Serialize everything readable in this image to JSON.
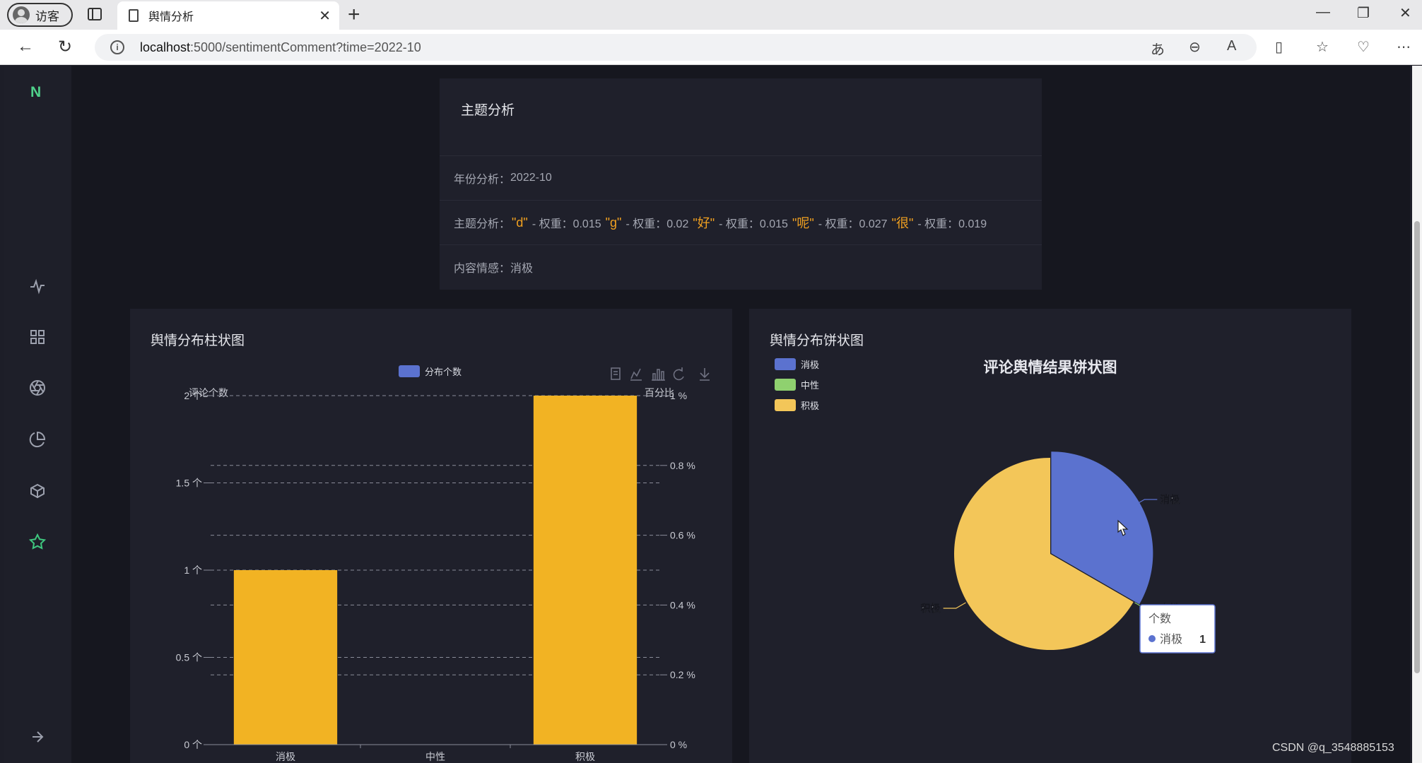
{
  "browser": {
    "profile_label": "访客",
    "tab_title": "舆情分析",
    "url_host": "localhost",
    "url_path": ":5000/sentimentComment?time=2022-10"
  },
  "sidebar": {
    "logo": "N",
    "items": [
      "activity-icon",
      "grid-icon",
      "aperture-icon",
      "pie-icon",
      "box-icon",
      "star-icon"
    ],
    "expand_icon": "arrow-right-icon"
  },
  "topic": {
    "title": "主题分析",
    "year_label": "年份分析：",
    "year_value": "2022-10",
    "theme_label": "主题分析：",
    "keywords": [
      {
        "word": "\"d\"",
        "rest": "- 权重：0.015"
      },
      {
        "word": "\"g\"",
        "rest": "- 权重：0.02"
      },
      {
        "word": "\"好\"",
        "rest": "- 权重：0.015"
      },
      {
        "word": "\"呢\"",
        "rest": "- 权重：0.027"
      },
      {
        "word": "\"很\"",
        "rest": "- 权重：0.019"
      }
    ],
    "sentiment_label": "内容情感：",
    "sentiment_value": "消极"
  },
  "bar_card": {
    "title": "舆情分布柱状图"
  },
  "pie_card": {
    "title": "舆情分布饼状图"
  },
  "chart_data": [
    {
      "type": "bar",
      "legend": [
        "分布个数"
      ],
      "categories": [
        "消极",
        "中性",
        "积极"
      ],
      "series": [
        {
          "name": "分布个数",
          "values": [
            1,
            0,
            2
          ]
        }
      ],
      "ylabel": "评论个数",
      "ylabel_right": "百分比",
      "ylim": [
        0,
        2
      ],
      "yticks": [
        "0 个",
        "0.5 个",
        "1 个",
        "1.5 个",
        "2 个"
      ],
      "yticks_right": [
        "0 %",
        "0.2 %",
        "0.4 %",
        "0.6 %",
        "0.8 %",
        "1 %"
      ],
      "bar_color": "#f2b323",
      "toolbox": [
        "data-view-icon",
        "line-icon",
        "bar-icon",
        "restore-icon",
        "download-icon"
      ]
    },
    {
      "type": "pie",
      "title": "评论舆情结果饼状图",
      "labels": [
        "消极",
        "中性",
        "积极"
      ],
      "values": [
        1,
        0,
        2
      ],
      "colors": [
        "#5b72cf",
        "#8fd16f",
        "#f3c659"
      ],
      "tooltip": {
        "title": "个数",
        "name": "消极",
        "value": "1"
      }
    }
  ],
  "watermark": "CSDN @q_3548885153"
}
